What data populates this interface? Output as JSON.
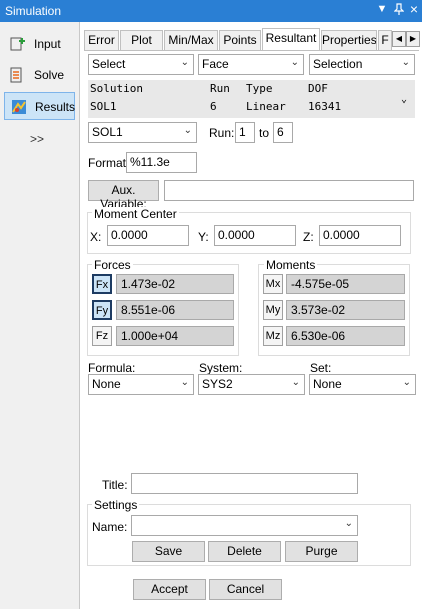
{
  "window": {
    "title": "Simulation",
    "dropdown_glyph": "▼",
    "pin_glyph": "📌",
    "close_glyph": "×"
  },
  "nav": {
    "items": [
      {
        "label": "Input",
        "icon": "input-plus-icon"
      },
      {
        "label": "Solve",
        "icon": "solve-list-icon"
      },
      {
        "label": "Results",
        "icon": "results-chart-icon"
      }
    ],
    "expand_label": ">>"
  },
  "tabs": [
    "Error",
    "Plot",
    "Min/Max",
    "Points",
    "Resultant",
    "Properties",
    "F"
  ],
  "active_tab": "Resultant",
  "selectors": {
    "select": "Select",
    "face": "Face",
    "selection": "Selection"
  },
  "solution_table": {
    "headers": [
      "Solution",
      "Run",
      "Type",
      "DOF"
    ],
    "row": [
      "SOL1",
      "6",
      "Linear",
      "16341"
    ]
  },
  "solution_select": "SOL1",
  "run": {
    "label": "Run:",
    "from": "1",
    "to_label": "to",
    "to": "6"
  },
  "format": {
    "label": "Format:",
    "value": "%11.3e"
  },
  "aux_variable": {
    "button": "Aux. Variable:",
    "value": ""
  },
  "moment_center": {
    "title": "Moment Center",
    "x_label": "X:",
    "x": "0.0000",
    "y_label": "Y:",
    "y": "0.0000",
    "z_label": "Z:",
    "z": "0.0000"
  },
  "forces": {
    "title": "Forces",
    "items": [
      {
        "label": "Fx",
        "value": "1.473e-02"
      },
      {
        "label": "Fy",
        "value": "8.551e-06"
      },
      {
        "label": "Fz",
        "value": "1.000e+04"
      }
    ]
  },
  "moments": {
    "title": "Moments",
    "items": [
      {
        "label": "Mx",
        "value": "-4.575e-05"
      },
      {
        "label": "My",
        "value": "3.573e-02"
      },
      {
        "label": "Mz",
        "value": "6.530e-06"
      }
    ]
  },
  "formula": {
    "label": "Formula:",
    "value": "None"
  },
  "system": {
    "label": "System:",
    "value": "SYS2"
  },
  "set": {
    "label": "Set:",
    "value": "None"
  },
  "title_field": {
    "label": "Title:",
    "value": ""
  },
  "settings": {
    "title": "Settings",
    "name_label": "Name:",
    "name_value": "",
    "save": "Save",
    "delete": "Delete",
    "purge": "Purge"
  },
  "actions": {
    "accept": "Accept",
    "cancel": "Cancel"
  },
  "colors": {
    "titlebar": "#2a7fd4",
    "active_nav": "#cce4f7",
    "readout_bg": "#d4d4d4"
  }
}
